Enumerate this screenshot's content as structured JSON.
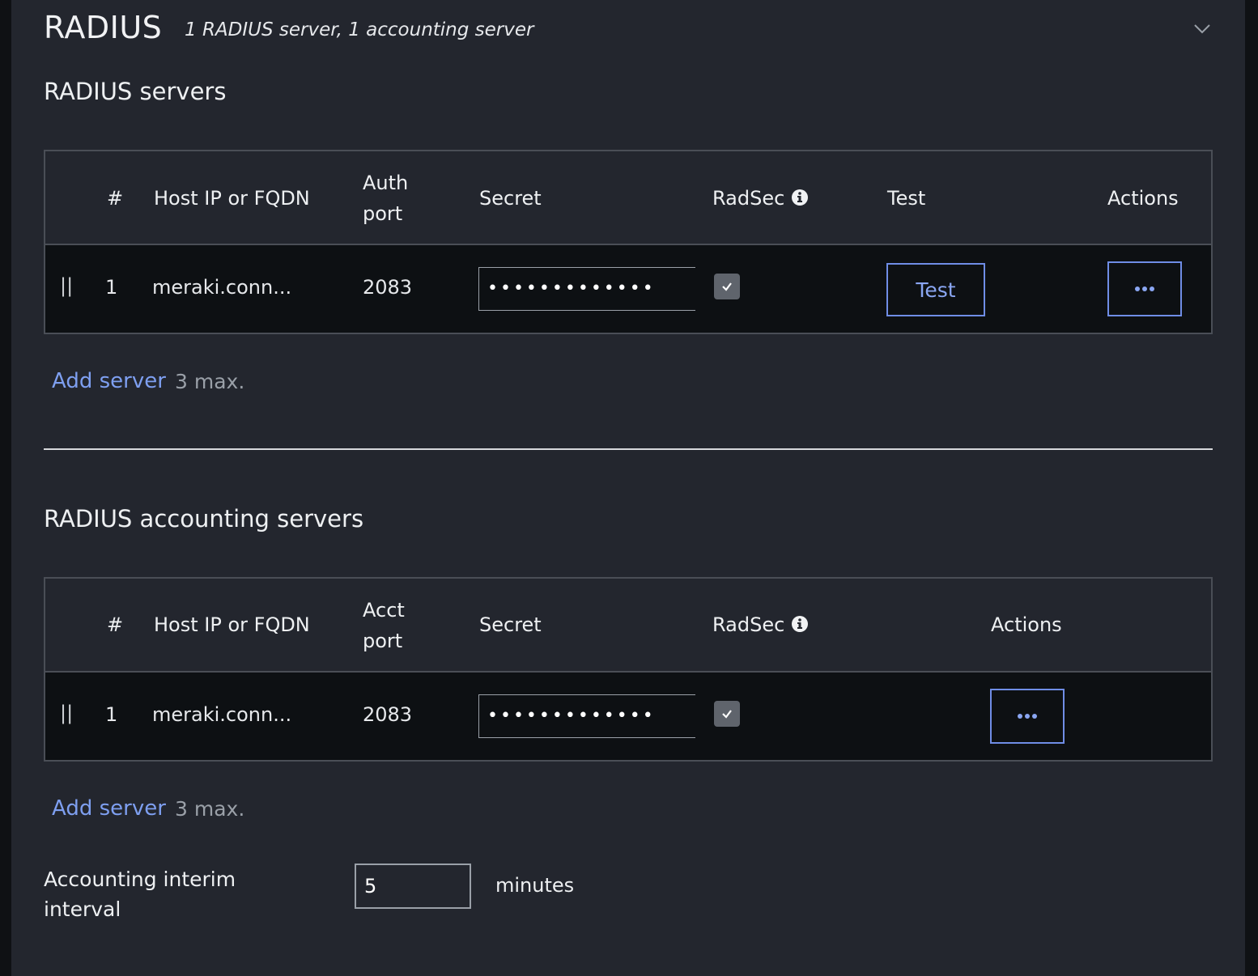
{
  "header": {
    "title": "RADIUS",
    "subtitle": "1 RADIUS server, 1 accounting server"
  },
  "radius_servers": {
    "section_title": "RADIUS servers",
    "columns": [
      "#",
      "Host IP or FQDN",
      "Auth",
      "port",
      "Secret",
      "RadSec",
      "Test",
      "Actions"
    ],
    "rows": [
      {
        "drag": "||",
        "index": "1",
        "host": "meraki.conn...",
        "port": "2083",
        "secret": "•••••••••••••",
        "radsec": true,
        "test_label": "Test"
      }
    ],
    "add_server_label": "Add server",
    "max_label": "3 max."
  },
  "accounting_servers": {
    "section_title": "RADIUS accounting servers",
    "columns": [
      "#",
      "Host IP or FQDN",
      "Acct",
      "port",
      "Secret",
      "RadSec",
      "Actions"
    ],
    "rows": [
      {
        "drag": "||",
        "index": "1",
        "host": "meraki.conn...",
        "port": "2083",
        "secret": "•••••••••••••",
        "radsec": true
      }
    ],
    "add_server_label": "Add server",
    "max_label": "3 max."
  },
  "interim": {
    "label_line1": "Accounting interim",
    "label_line2": "interval",
    "value": "5",
    "unit": "minutes"
  },
  "colors": {
    "panel_bg": "#23262e",
    "row_bg": "#0d1013",
    "accent": "#7e9ff0",
    "border": "#4a4e56"
  }
}
